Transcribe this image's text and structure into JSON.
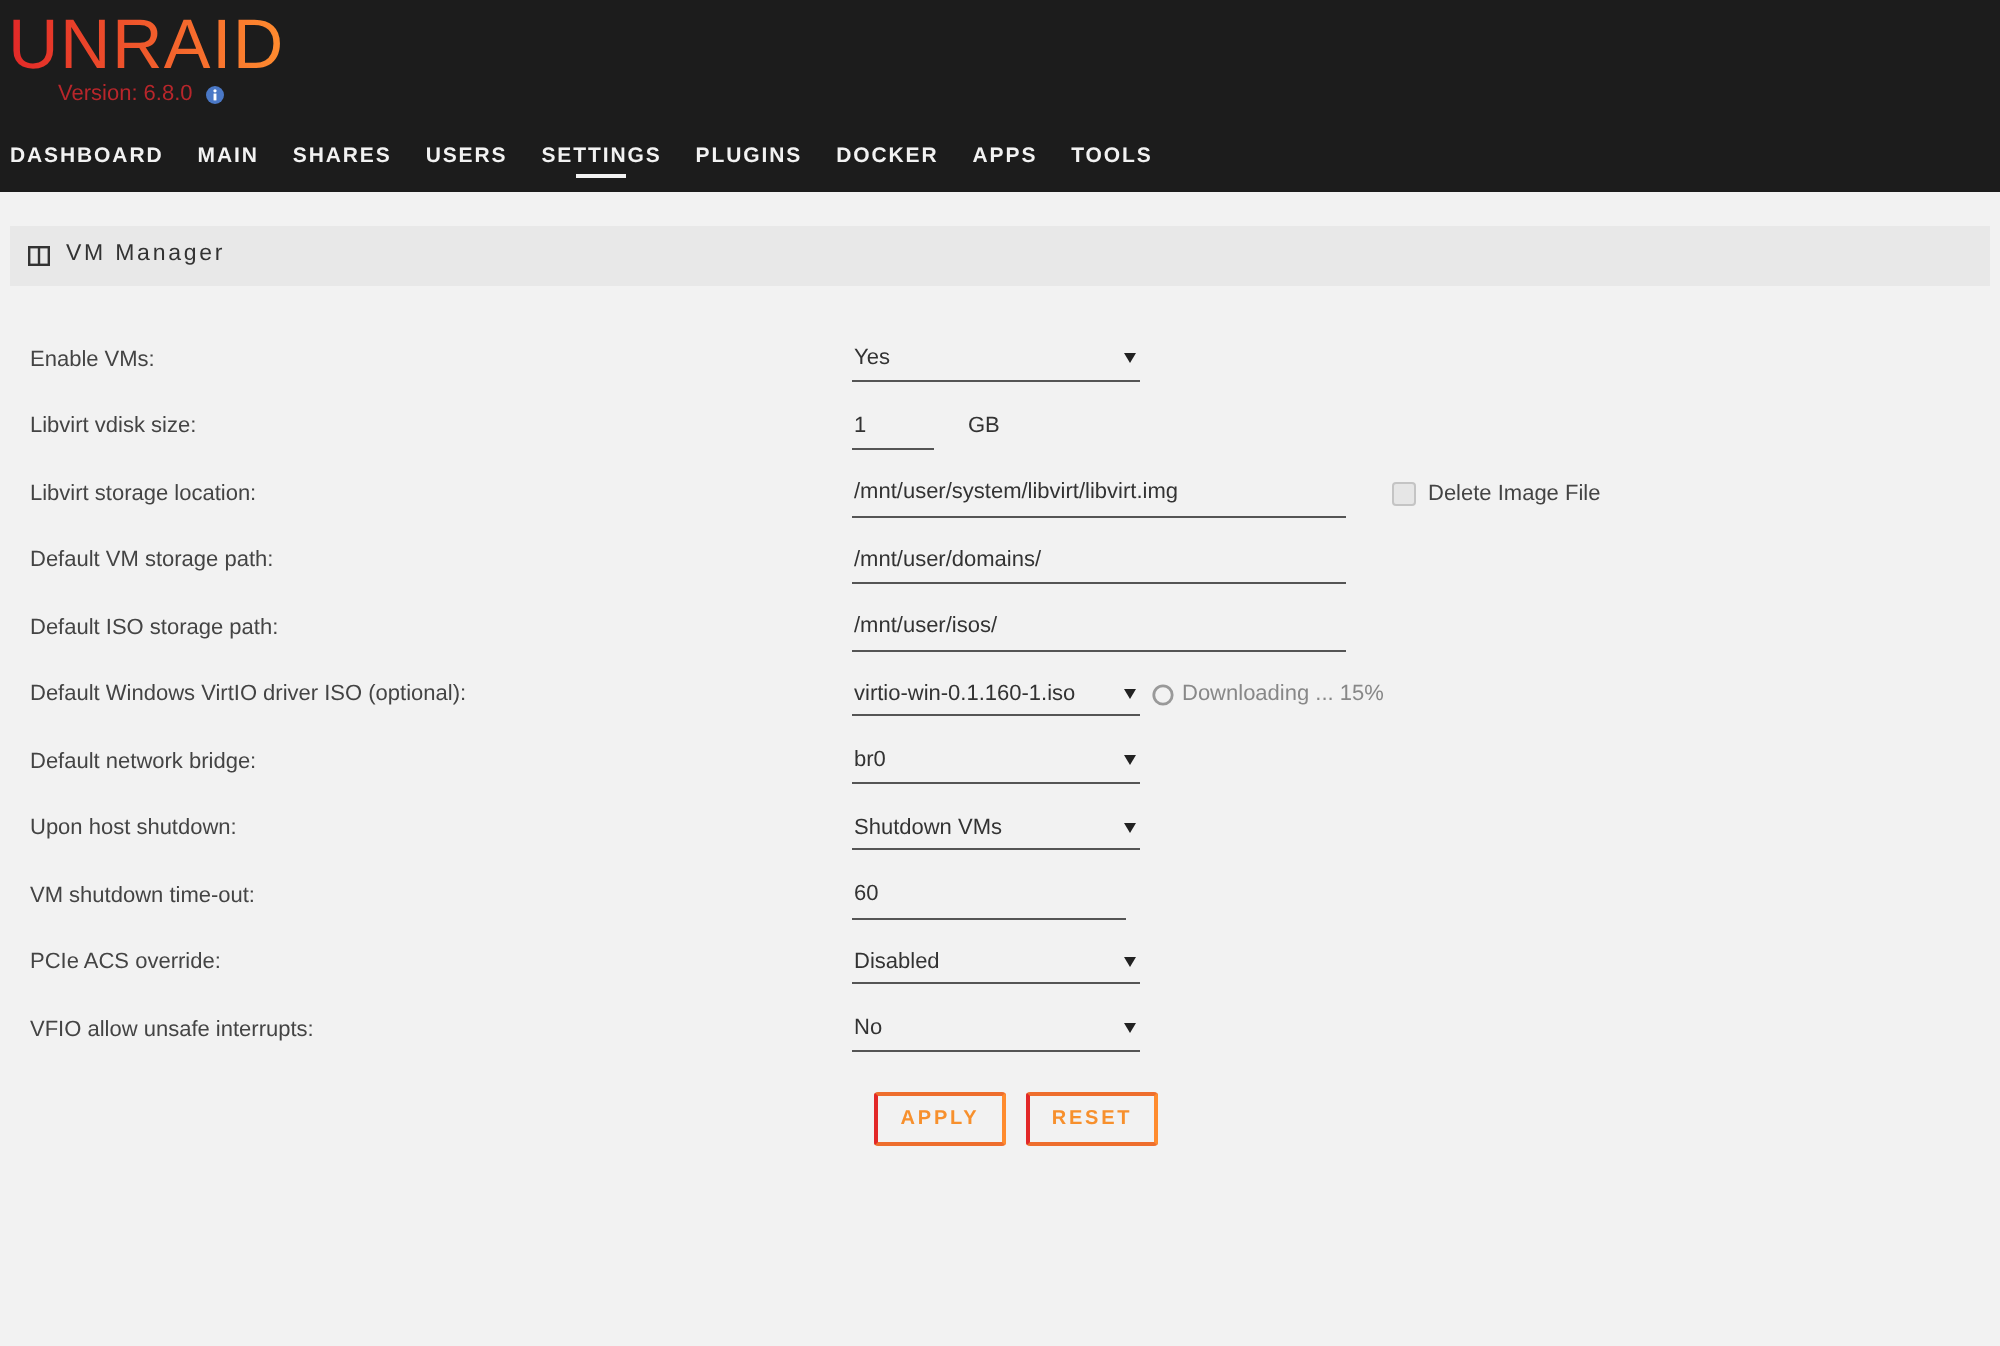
{
  "header": {
    "logo": "UNRAID",
    "version": "Version: 6.8.0"
  },
  "nav": [
    {
      "label": "DASHBOARD",
      "selected": false
    },
    {
      "label": "MAIN",
      "selected": false
    },
    {
      "label": "SHARES",
      "selected": false
    },
    {
      "label": "USERS",
      "selected": false
    },
    {
      "label": "SETTINGS",
      "selected": true
    },
    {
      "label": "PLUGINS",
      "selected": false
    },
    {
      "label": "DOCKER",
      "selected": false
    },
    {
      "label": "APPS",
      "selected": false
    },
    {
      "label": "TOOLS",
      "selected": false
    }
  ],
  "panel": {
    "title": "VM Manager"
  },
  "settings": [
    {
      "kind": "select",
      "label": "Enable VMs:",
      "value": "Yes"
    },
    {
      "kind": "size",
      "label": "Libvirt vdisk size:",
      "value": "1",
      "unit": "GB"
    },
    {
      "kind": "path",
      "label": "Libvirt storage location:",
      "value": "/mnt/user/system/libvirt/libvirt.img",
      "checkbox": {
        "label": "Delete Image File",
        "checked": false
      }
    },
    {
      "kind": "path",
      "label": "Default VM storage path:",
      "value": "/mnt/user/domains/"
    },
    {
      "kind": "path",
      "label": "Default ISO storage path:",
      "value": "/mnt/user/isos/"
    },
    {
      "kind": "select",
      "label": "Default Windows VirtIO driver ISO (optional):",
      "value": "virtio-win-0.1.160-1.iso",
      "status": "Downloading ... 15%"
    },
    {
      "kind": "select",
      "label": "Default network bridge:",
      "value": "br0"
    },
    {
      "kind": "select",
      "label": "Upon host shutdown:",
      "value": "Shutdown VMs"
    },
    {
      "kind": "number",
      "label": "VM shutdown time-out:",
      "value": "60"
    },
    {
      "kind": "select",
      "label": "PCIe ACS override:",
      "value": "Disabled"
    },
    {
      "kind": "select",
      "label": "VFIO allow unsafe interrupts:",
      "value": "No"
    }
  ],
  "buttons": [
    "APPLY",
    "RESET"
  ]
}
